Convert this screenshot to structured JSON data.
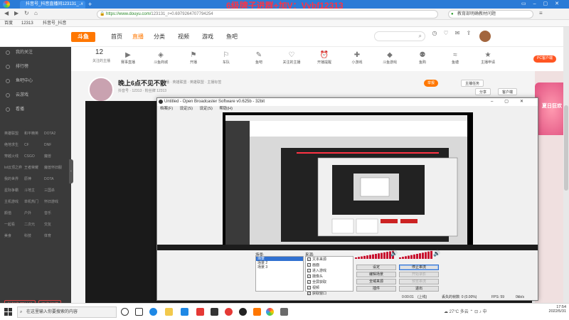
{
  "browser": {
    "tab_title": "抖音号_抖音直播间123131_…",
    "overlay_title": "6级牌子进群+加V：Vybf12313",
    "url_host": "https://www.douyu.com/",
    "url_path": "123131_r=0.6979264707794254",
    "search_placeholder": "教育部明确教材问题",
    "bookmarks": [
      "百度",
      "12313",
      "抖音号_抖音"
    ]
  },
  "douyu": {
    "logo": "斗鱼",
    "nav": [
      "首页",
      "直播",
      "分类",
      "视频",
      "游戏",
      "鱼吧"
    ],
    "follow_count": "12",
    "follow_label": "关注的主播",
    "categories": [
      "赛事直播",
      "斗鱼商城",
      "开播",
      "车队",
      "鱼吧",
      "关注的主播",
      "开播提醒",
      "小游戏",
      "斗鱼游戏",
      "鱼购",
      "鱼塘",
      "主播申请"
    ],
    "pc_client": "PC客户端",
    "sidebar": {
      "items": [
        "我的关注",
        "排行榜",
        "鱼吧中心",
        "云游戏",
        "看播"
      ],
      "grid": [
        "英雄联盟",
        "和平精英",
        "DOTA2",
        "绝地求生",
        "CF",
        "DNF",
        "穿越火线",
        "CSGO",
        "魔兽",
        "lol云顶之弈",
        "王者荣耀",
        "魔兽怀旧服",
        "我的世界",
        "原神",
        "DOTA",
        "星际争霸",
        "斗地主",
        "三国杀",
        "主机游戏",
        "单机热门",
        "怀旧游戏",
        "颜值",
        "户外",
        "音乐",
        "一起看",
        "二次元",
        "交友",
        "美食",
        "科技",
        "体育"
      ],
      "btn_a": "发起鱼吧讨论",
      "btn_b": "更多频道"
    },
    "room": {
      "title": "晚上6点不见不散",
      "meta1": "直播  · 英雄联盟  · 英雄联盟 · 主播标签",
      "meta2": "抖音号  · 12313  · 粉丝牌 12313",
      "btn_report": "举报",
      "btn_follow": "主播任务",
      "btn_a": "分享",
      "btn_b": "客户端"
    },
    "right_promo": "夏日狂欢"
  },
  "obs": {
    "title": "Untitled - Open Broadcaster Software v0.625b - 32bit",
    "menu": [
      "档案(F)",
      "设定(S)",
      "设定(S)",
      "帮助(H)"
    ],
    "scenes_label": "场景:",
    "sources_label": "来源:",
    "scenes": [
      "场景",
      "场景 2",
      "场景 3"
    ],
    "sources": [
      "文本来源",
      "画面",
      "进入游戏",
      "摄像头",
      "全屏获取",
      "视频",
      "获取窗口"
    ],
    "buttons": {
      "settings": "设定",
      "start_stream": "停止串流",
      "edit_scene": "编辑场景",
      "start_record": "开始录影",
      "global_sources": "全域来源",
      "preview": "预览串流",
      "plugins": "插件",
      "exit": "退出"
    },
    "status": {
      "time": "0:00:01",
      "live": "(上线)",
      "dropped": "丢失的帧数: 0 (0.00%)",
      "fps": "FPS: 59",
      "bitrate": "0kb/s"
    }
  },
  "taskbar": {
    "search_placeholder": "在这里输入你要搜索的内容",
    "weather": "27°C 多云",
    "lang": "中",
    "time": "17:54",
    "date": "2022/5/31"
  }
}
